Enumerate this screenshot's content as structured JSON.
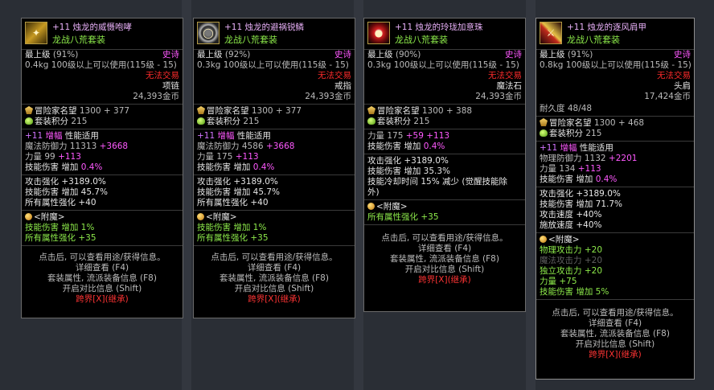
{
  "tooltips": [
    {
      "icon": "necklace-icon",
      "name": "+11 烛龙的威慑咆哮",
      "set": "龙战八荒套装",
      "grade": "最上级",
      "grade_pct": "(91%)",
      "rarity": "史诗",
      "weight": "0.4kg",
      "level_req": "100级以上可以使用(115级 - 15)",
      "trade": "无法交易",
      "type": "项链",
      "price": "24,393金币",
      "durability": "",
      "fame_label": "冒险家名望",
      "fame_value": "1300 + 377",
      "points_label": "套装积分",
      "points_value": "215",
      "amp_prefix": "+11",
      "amp_label": "增幅",
      "amp_suffix": "性能适用",
      "stats": [
        {
          "label": "魔法防御力",
          "base": "11313",
          "bonus": "+3668"
        },
        {
          "label": "力量",
          "base": "99",
          "bonus": "+113"
        }
      ],
      "skill_dmg": {
        "label": "技能伤害",
        "mid": "增加",
        "val": "0.4%"
      },
      "effects": [
        "攻击强化 +3189.0%",
        "技能伤害  增加 45.7%",
        "所有属性强化 +40"
      ],
      "enchant_title": "<附魔>",
      "enchants": [
        "技能伤害  增加 1%",
        "所有属性强化 +35"
      ],
      "footer": [
        "点击后, 可以查看用途/获得信息。",
        "详细查看 (F4)",
        "套装属性, 流派装备信息 (F8)",
        "开启对比信息 (Shift)"
      ],
      "transfer": "跨界[X](继承)"
    },
    {
      "icon": "bracelet-icon",
      "name": "+11 烛龙的避祸锐鳞",
      "set": "龙战八荒套装",
      "grade": "最上级",
      "grade_pct": "(92%)",
      "rarity": "史诗",
      "weight": "0.3kg",
      "level_req": "100级以上可以使用(115级 - 15)",
      "trade": "无法交易",
      "type": "戒指",
      "price": "24,393金币",
      "durability": "",
      "fame_label": "冒险家名望",
      "fame_value": "1300 + 377",
      "points_label": "套装积分",
      "points_value": "215",
      "amp_prefix": "+11",
      "amp_label": "增幅",
      "amp_suffix": "性能适用",
      "stats": [
        {
          "label": "魔法防御力",
          "base": "4586",
          "bonus": "+3668"
        },
        {
          "label": "力量",
          "base": "175",
          "bonus": "+113"
        }
      ],
      "skill_dmg": {
        "label": "技能伤害",
        "mid": "增加",
        "val": "0.4%"
      },
      "effects": [
        "攻击强化 +3189.0%",
        "技能伤害  增加 45.7%",
        "所有属性强化 +40"
      ],
      "enchant_title": "<附魔>",
      "enchants": [
        "技能伤害  增加 1%",
        "所有属性强化 +35"
      ],
      "footer": [
        "点击后, 可以查看用途/获得信息。",
        "详细查看 (F4)",
        "套装属性, 流派装备信息 (F8)",
        "开启对比信息 (Shift)"
      ],
      "transfer": "跨界[X](继承)"
    },
    {
      "icon": "magic-stone-icon",
      "name": "+11 烛龙的玲珑加意珠",
      "set": "龙战八荒套装",
      "grade": "最上级",
      "grade_pct": "(90%)",
      "rarity": "史诗",
      "weight": "0.3kg",
      "level_req": "100级以上可以使用(115级 - 15)",
      "trade": "无法交易",
      "type": "魔法石",
      "price": "24,393金币",
      "durability": "",
      "fame_label": "冒险家名望",
      "fame_value": "1300 + 388",
      "points_label": "套装积分",
      "points_value": "215",
      "amp_prefix": "",
      "amp_label": "",
      "amp_suffix": "",
      "stats": [
        {
          "label": "力量",
          "base": "175",
          "bonus": "+59 +113"
        }
      ],
      "skill_dmg": {
        "label": "技能伤害",
        "mid": "增加",
        "val": "0.4%"
      },
      "effects": [
        "攻击强化 +3189.0%",
        "技能伤害  增加 35.3%",
        "技能冷却时间 15% 减少 (觉醒技能除",
        "外)"
      ],
      "enchant_title": "<附魔>",
      "enchants": [
        "所有属性强化 +35"
      ],
      "footer": [
        "点击后, 可以查看用途/获得信息。",
        "详细查看 (F4)",
        "套装属性, 流派装备信息 (F8)",
        "开启对比信息 (Shift)"
      ],
      "transfer": "跨界[X](继承)"
    },
    {
      "icon": "shoulder-icon",
      "name": "+11 烛龙的逐风肩甲",
      "set": "龙战八荒套装",
      "grade": "最上级",
      "grade_pct": "(91%)",
      "rarity": "史诗",
      "weight": "0.8kg",
      "level_req": "100级以上可以使用(115级 - 15)",
      "trade": "无法交易",
      "type": "头肩",
      "price": "17,424金币",
      "durability": "耐久度 48/48",
      "fame_label": "冒险家名望",
      "fame_value": "1300 + 468",
      "points_label": "套装积分",
      "points_value": "215",
      "amp_prefix": "+11",
      "amp_label": "增幅",
      "amp_suffix": "性能适用",
      "stats": [
        {
          "label": "物理防御力",
          "base": "1132",
          "bonus": "+2201"
        },
        {
          "label": "力量",
          "base": "134",
          "bonus": "+113"
        }
      ],
      "skill_dmg": {
        "label": "技能伤害",
        "mid": "增加",
        "val": "0.4%"
      },
      "effects": [
        "攻击强化 +3189.0%",
        "技能伤害  增加 71.7%",
        "攻击速度 +40%",
        "施放速度 +40%"
      ],
      "enchant_title": "<附魔>",
      "enchants4": [
        {
          "text": "物理攻击力 +20",
          "cls": "grn"
        },
        {
          "text": "魔法攻击力 +20",
          "cls": "dim"
        },
        {
          "text": "独立攻击力 +20",
          "cls": "grn"
        },
        {
          "text": "力量 +75",
          "cls": "grn"
        },
        {
          "text": "技能伤害  增加 5%",
          "cls": "grn"
        }
      ],
      "footer": [
        "点击后, 可以查看用途/获得信息。",
        "详细查看 (F4)",
        "套装属性, 流派装备信息 (F8)",
        "开启对比信息 (Shift)"
      ],
      "transfer": "跨界[X](继承)"
    }
  ]
}
